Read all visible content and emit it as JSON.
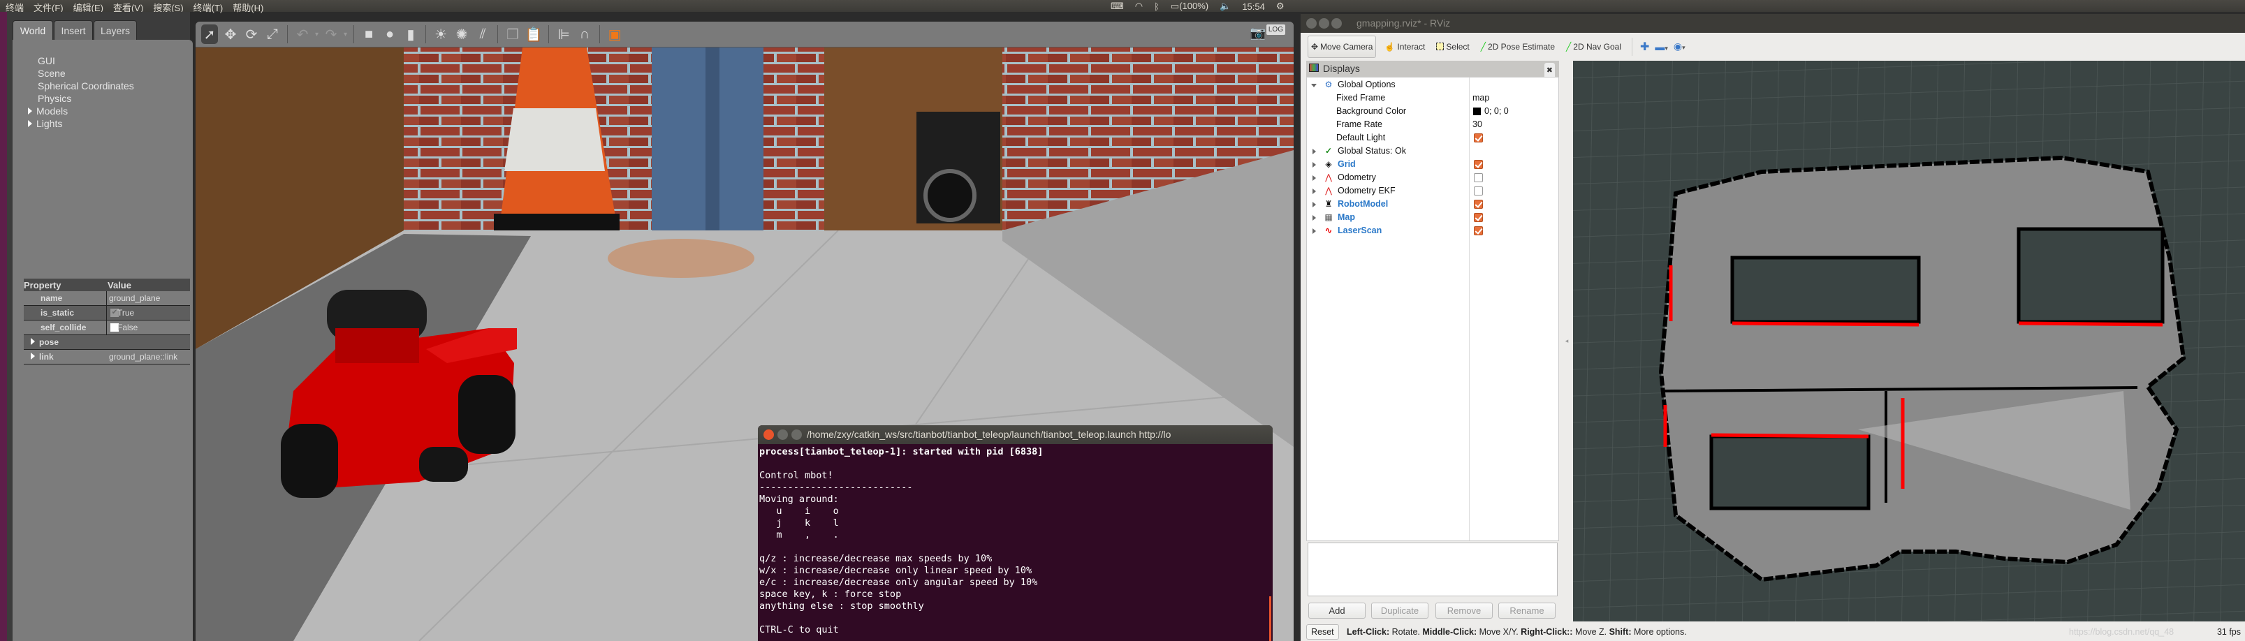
{
  "topbar": {
    "menus": [
      "终端",
      "文件(F)",
      "编辑(E)",
      "查看(V)",
      "搜索(S)",
      "终端(T)",
      "帮助(H)"
    ],
    "battery": "(100%)",
    "time": "15:54",
    "icons": [
      "keyboard-icon",
      "wifi-icon",
      "bluetooth-icon",
      "battery-icon",
      "volume-icon",
      "power-gear-icon"
    ]
  },
  "gazebo": {
    "tabs": [
      "World",
      "Insert",
      "Layers"
    ],
    "tree": [
      {
        "label": "GUI",
        "expandable": false
      },
      {
        "label": "Scene",
        "expandable": false
      },
      {
        "label": "Spherical Coordinates",
        "expandable": false
      },
      {
        "label": "Physics",
        "expandable": false
      },
      {
        "label": "Models",
        "expandable": true
      },
      {
        "label": "Lights",
        "expandable": true
      }
    ],
    "properties": {
      "header": [
        "Property",
        "Value"
      ],
      "rows": [
        {
          "key": "name",
          "value": "ground_plane"
        },
        {
          "key": "is_static",
          "value": "True",
          "checkbox": true
        },
        {
          "key": "self_collide",
          "value": "False",
          "checkbox": false
        },
        {
          "key": "pose",
          "value": "",
          "expandable": true
        },
        {
          "key": "link",
          "value": "ground_plane::link",
          "expandable": true
        }
      ]
    },
    "toolbar": [
      "select-arrow",
      "translate",
      "rotate",
      "scale",
      "undo",
      "redo",
      "box",
      "sphere",
      "cylinder",
      "point-light",
      "spot-light",
      "directional-light",
      "copy",
      "paste",
      "align",
      "snap",
      "view-angle",
      "screenshot",
      "log"
    ]
  },
  "terminal": {
    "title": "/home/zxy/catkin_ws/src/tianbot/tianbot_teleop/launch/tianbot_teleop.launch http://lo",
    "first_line": "process[tianbot_teleop-1]: started with pid [6838]",
    "output": "\nControl mbot!\n---------------------------\nMoving around:\n   u    i    o\n   j    k    l\n   m    ,    .\n\nq/z : increase/decrease max speeds by 10%\nw/x : increase/decrease only linear speed by 10%\ne/c : increase/decrease only angular speed by 10%\nspace key, k : force stop\nanything else : stop smoothly\n\nCTRL-C to quit"
  },
  "rviz": {
    "title": "gmapping.rviz* - RViz",
    "tools": [
      "Move Camera",
      "Interact",
      "Select",
      "2D Pose Estimate",
      "2D Nav Goal"
    ],
    "displays_title": "Displays",
    "displays": [
      {
        "label": "Global Options",
        "value": ""
      },
      {
        "label": "Fixed Frame",
        "value": "map"
      },
      {
        "label": "Background Color",
        "value": "0; 0; 0",
        "swatch": "#000000"
      },
      {
        "label": "Frame Rate",
        "value": "30"
      },
      {
        "label": "Default Light",
        "checked": true
      },
      {
        "label": "Global Status: Ok",
        "value": ""
      },
      {
        "label": "Grid",
        "checked": true
      },
      {
        "label": "Odometry",
        "checked": false
      },
      {
        "label": "Odometry EKF",
        "checked": false
      },
      {
        "label": "RobotModel",
        "checked": true
      },
      {
        "label": "Map",
        "checked": true
      },
      {
        "label": "LaserScan",
        "checked": true
      }
    ],
    "buttons": [
      "Add",
      "Duplicate",
      "Remove",
      "Rename"
    ],
    "reset": "Reset",
    "hints": [
      {
        "key": "Left-Click:",
        "desc": " Rotate. "
      },
      {
        "key": "Middle-Click:",
        "desc": " Move X/Y. "
      },
      {
        "key": "Right-Click::",
        "desc": " Move Z. "
      },
      {
        "key": "Shift:",
        "desc": " More options."
      }
    ],
    "watermark": "https://blog.csdn.net/qq_48",
    "fps": "31 fps",
    "colors": {
      "checkbox": "#e8703a",
      "laser": "#ff0000",
      "map_free": "#8a8a8a",
      "background": "#3a4443"
    }
  }
}
